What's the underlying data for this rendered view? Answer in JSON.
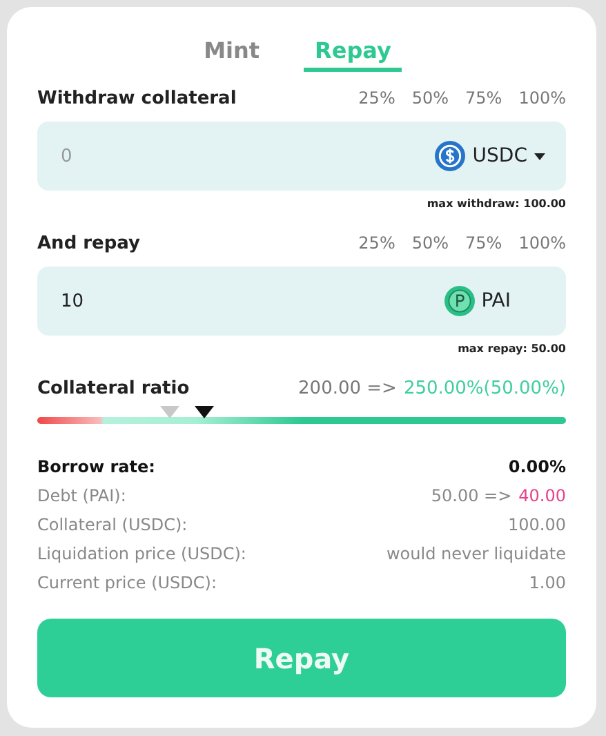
{
  "tabs": [
    {
      "label": "Mint",
      "selected": false
    },
    {
      "label": "Repay",
      "selected": true
    }
  ],
  "sections": [
    {
      "label": "Withdraw collateral",
      "percents": [
        "25%",
        "50%",
        "75%",
        "100%"
      ],
      "field": {
        "placeholder": "0"
      },
      "token": {
        "kind": "usdc",
        "symbol": "USDC",
        "dropdown": true
      },
      "max": "max withdraw: 100.00"
    },
    {
      "label": "And repay",
      "percents": [
        "25%",
        "50%",
        "75%",
        "100%"
      ],
      "field": {
        "value": "10"
      },
      "token": {
        "kind": "pai",
        "symbol": "PAI",
        "dropdown": false
      },
      "max": "max repay: 50.00"
    }
  ],
  "ratio": {
    "label": "Collateral ratio",
    "current": "200.00 =>",
    "new": "250.00%(50.00%)",
    "markers": [
      {
        "kind": "current",
        "level": 0.25
      },
      {
        "kind": "new",
        "level": 0.315
      }
    ]
  },
  "stats": [
    {
      "label": "Borrow rate:",
      "value": "0.00%",
      "bold": true
    },
    {
      "label": "Debt (PAI):",
      "value": "50.00 =>",
      "new_value": "40.00",
      "bold": false
    },
    {
      "label": "Collateral (USDC):",
      "value": "100.00",
      "bold": false
    },
    {
      "label": "Liquidation price (USDC):",
      "value": "would never liquidate",
      "bold": false
    },
    {
      "label": "Current price (USDC):",
      "value": "1.00",
      "bold": false
    }
  ],
  "button": "Repay"
}
